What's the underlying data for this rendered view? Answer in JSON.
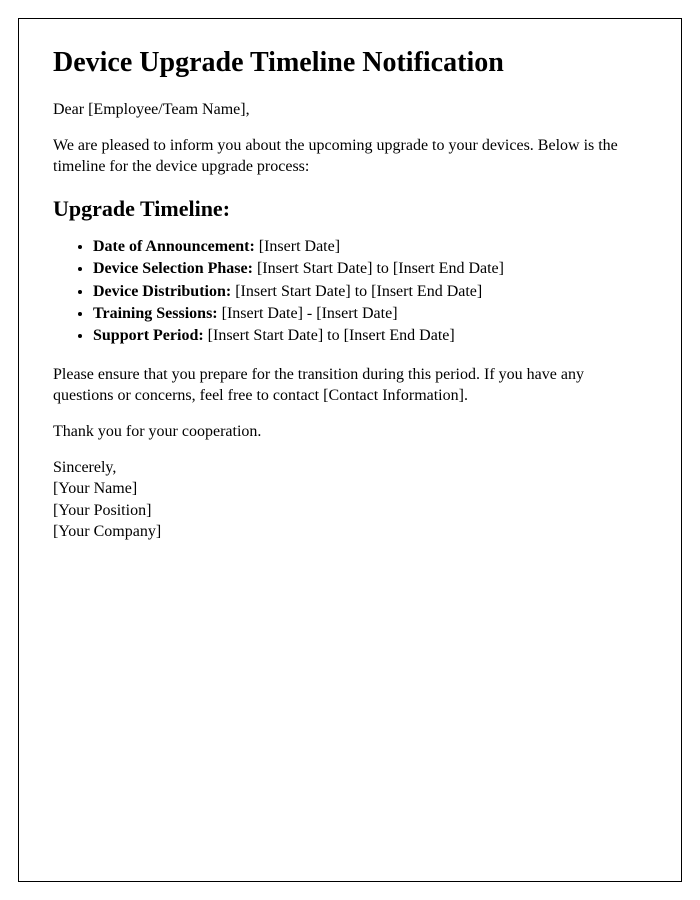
{
  "title": "Device Upgrade Timeline Notification",
  "salutation": "Dear [Employee/Team Name],",
  "intro": "We are pleased to inform you about the upcoming upgrade to your devices. Below is the timeline for the device upgrade process:",
  "timeline_heading": "Upgrade Timeline:",
  "timeline": [
    {
      "label": "Date of Announcement:",
      "value": " [Insert Date]"
    },
    {
      "label": "Device Selection Phase:",
      "value": " [Insert Start Date] to [Insert End Date]"
    },
    {
      "label": "Device Distribution:",
      "value": " [Insert Start Date] to [Insert End Date]"
    },
    {
      "label": "Training Sessions:",
      "value": " [Insert Date] - [Insert Date]"
    },
    {
      "label": "Support Period:",
      "value": " [Insert Start Date] to [Insert End Date]"
    }
  ],
  "closing_instructions": "Please ensure that you prepare for the transition during this period. If you have any questions or concerns, feel free to contact [Contact Information].",
  "thanks": "Thank you for your cooperation.",
  "signature": {
    "closing": "Sincerely,",
    "name": "[Your Name]",
    "position": "[Your Position]",
    "company": "[Your Company]"
  }
}
